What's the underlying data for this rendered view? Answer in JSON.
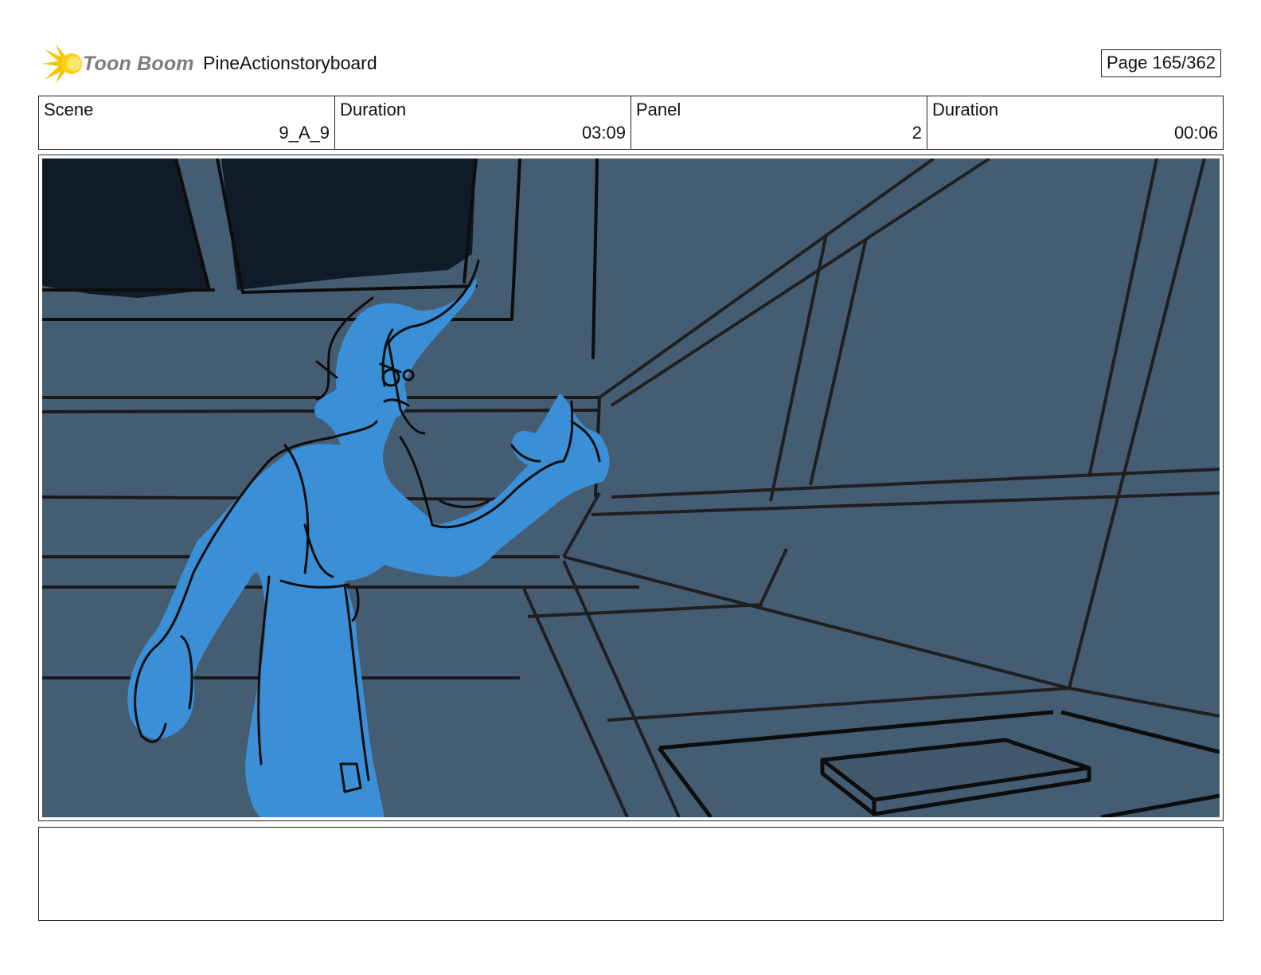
{
  "header": {
    "logo_text": "Toon Boom",
    "project_title": "PineActionstoryboard",
    "page_label": "Page 165/362"
  },
  "info": {
    "scene_label": "Scene",
    "scene_value": "9_A_9",
    "scene_duration_label": "Duration",
    "scene_duration_value": "03:09",
    "panel_label": "Panel",
    "panel_value": "2",
    "panel_duration_label": "Duration",
    "panel_duration_value": "00:06"
  },
  "panel": {
    "background_color": "#455d73",
    "character_color": "#3b8fd6",
    "line_color": "#0d0d0d"
  },
  "notes": {
    "text": ""
  }
}
